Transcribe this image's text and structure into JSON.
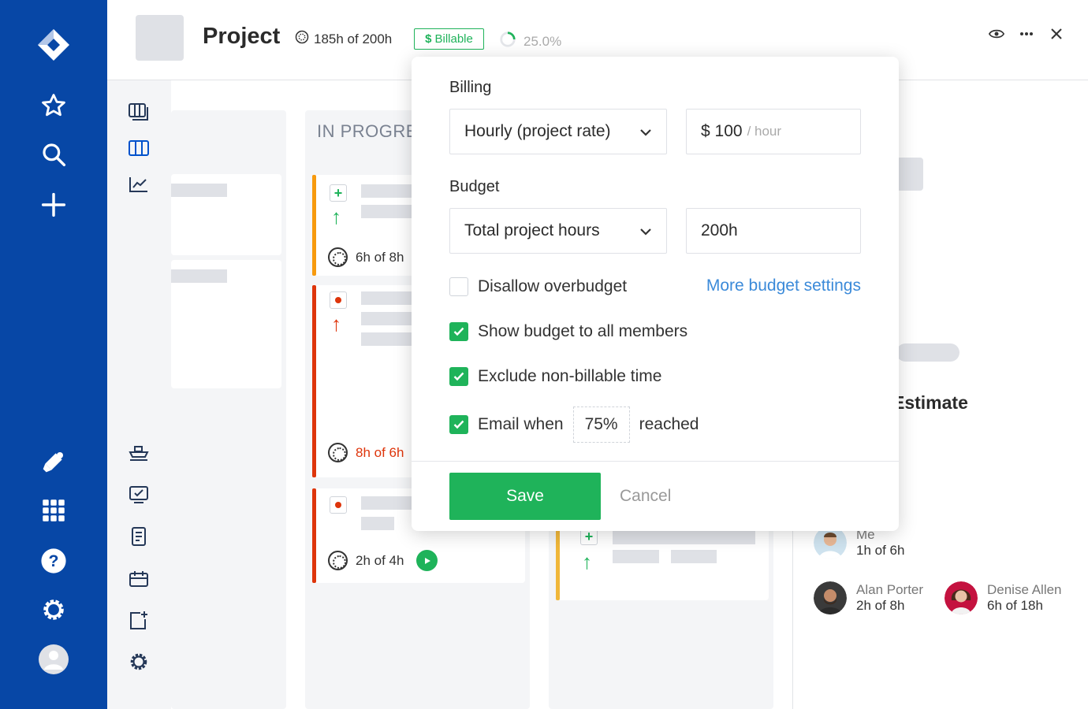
{
  "header": {
    "title": "Project",
    "hours": "185h of 200h",
    "billable_label": "Billable",
    "progress_pct": "25.0%"
  },
  "board": {
    "columns": [
      {
        "title": "IN PROGRESS"
      }
    ],
    "cards": [
      {
        "time": "6h of 8h"
      },
      {
        "time": "8h of 6h"
      },
      {
        "time": "2h of 4h"
      }
    ],
    "right_panel_heading": "Estimate"
  },
  "people": [
    {
      "name": "Me",
      "hours": "1h of 6h"
    },
    {
      "name": "Alan Porter",
      "hours": "2h of 8h"
    },
    {
      "name": "Denise Allen",
      "hours": "6h of 18h"
    }
  ],
  "popover": {
    "billing_label": "Billing",
    "billing_type": "Hourly (project rate)",
    "rate_value": "$ 100",
    "rate_unit": "/ hour",
    "budget_label": "Budget",
    "budget_type": "Total project hours",
    "budget_value": "200h",
    "disallow_overbudget": "Disallow overbudget",
    "more_settings": "More budget settings",
    "show_budget": "Show budget to all members",
    "exclude_nonbillable": "Exclude non-billable time",
    "email_when": "Email when",
    "email_pct": "75%",
    "reached": "reached",
    "save": "Save",
    "cancel": "Cancel"
  },
  "colors": {
    "nav_blue": "#0747a6",
    "green": "#1fb35a",
    "red": "#de350b",
    "orange": "#f79a0e",
    "yellow": "#f0b73a",
    "link_blue": "#3b8ad9"
  }
}
